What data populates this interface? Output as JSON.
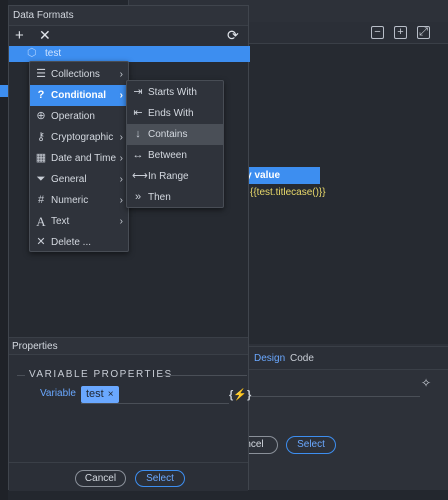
{
  "data_formats_panel": {
    "title": "Data Formats",
    "toolbar": {
      "add_icon": "plus-icon",
      "remove_icon": "close-icon",
      "refresh_icon": "refresh-icon"
    },
    "tree": {
      "selected_item": "test",
      "item_icon": "cube-icon"
    }
  },
  "category_menu": {
    "items": [
      {
        "label": "Collections",
        "icon": "list-icon",
        "has_submenu": true
      },
      {
        "label": "Conditional",
        "icon": "question-icon",
        "has_submenu": true,
        "active": true
      },
      {
        "label": "Operation",
        "icon": "arrow-circle-icon",
        "has_submenu": false
      },
      {
        "label": "Cryptographic",
        "icon": "key-icon",
        "has_submenu": true
      },
      {
        "label": "Date and Time",
        "icon": "calendar-icon",
        "has_submenu": true
      },
      {
        "label": "General",
        "icon": "filter-icon",
        "has_submenu": true
      },
      {
        "label": "Numeric",
        "icon": "hash-icon",
        "has_submenu": true
      },
      {
        "label": "Text",
        "icon": "text-icon",
        "has_submenu": true
      },
      {
        "label": "Delete ...",
        "icon": "close-icon",
        "has_submenu": false
      }
    ]
  },
  "conditional_submenu": {
    "items": [
      {
        "label": "Starts With",
        "icon": "starts-with-icon"
      },
      {
        "label": "Ends With",
        "icon": "ends-with-icon"
      },
      {
        "label": "Contains",
        "icon": "contains-icon",
        "hovered": true
      },
      {
        "label": "Between",
        "icon": "between-icon"
      },
      {
        "label": "In Range",
        "icon": "in-range-icon"
      },
      {
        "label": "Then",
        "icon": "then-icon"
      }
    ]
  },
  "properties": {
    "header": "Properties",
    "section_title": "VARIABLE PROPERTIES",
    "variable_label": "Variable",
    "variable_token": "test",
    "token_remove": "×",
    "dynamic_icon": "lightning-icon",
    "dynamic_glyph": "{⚡}"
  },
  "footer": {
    "cancel_label": "Cancel",
    "select_label": "Select"
  },
  "background_dialog": {
    "highlighted_text": "ny value",
    "expression": "{{test.titlecase()}}",
    "tabs": [
      {
        "label": "Design",
        "active": true
      },
      {
        "label": "Code",
        "active": false
      }
    ],
    "cancel_label": "ncel",
    "select_label": "Select",
    "toolbar_icons": [
      "minimize-icon",
      "add-icon",
      "maximize-icon"
    ]
  },
  "colors": {
    "accent": "#3d8ef0",
    "panel_bg": "#2b2f37",
    "expression": "#e8d86a"
  }
}
